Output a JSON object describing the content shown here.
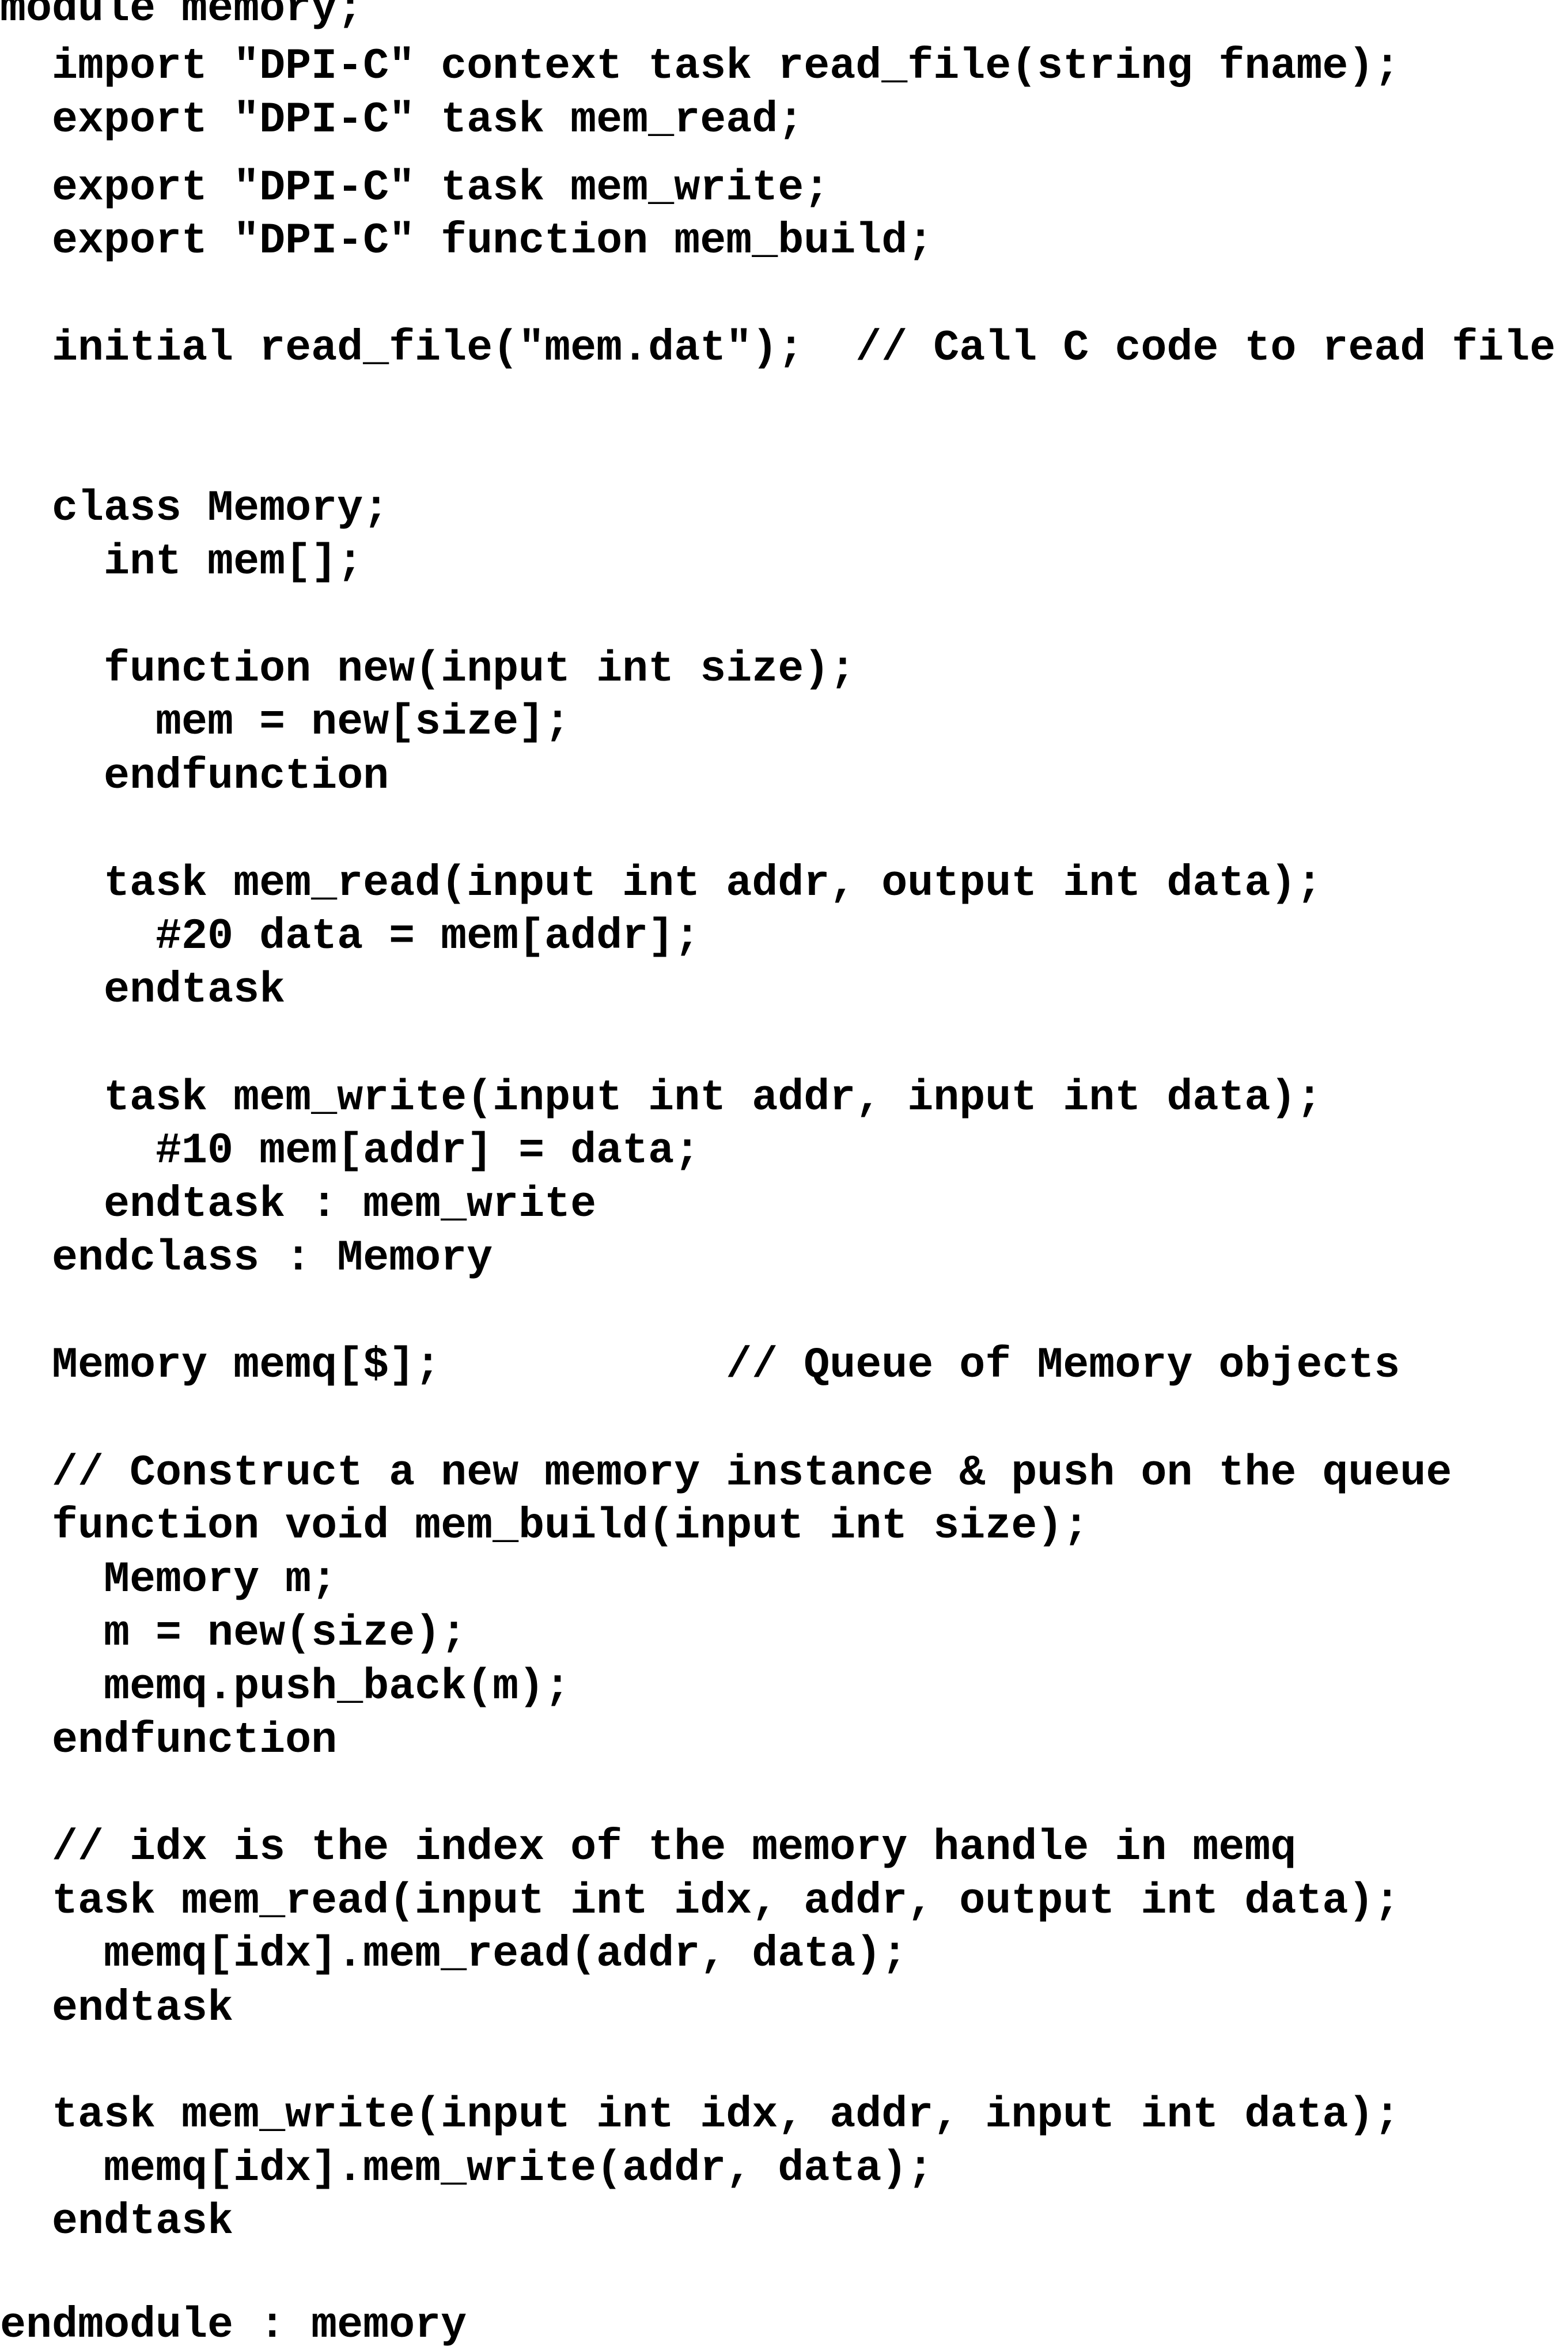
{
  "code_lines": [
    "module memory;",
    "  import \"DPI-C\" context task read_file(string fname);",
    "  export \"DPI-C\" task mem_read;",
    "  export \"DPI-C\" task mem_write;",
    "  export \"DPI-C\" function mem_build;",
    "  initial read_file(\"mem.dat\");  // Call C code to read file",
    "  class Memory;",
    "    int mem[];",
    "    function new(input int size);",
    "      mem = new[size];",
    "    endfunction",
    "    task mem_read(input int addr, output int data);",
    "      #20 data = mem[addr];",
    "    endtask",
    "    task mem_write(input int addr, input int data);",
    "      #10 mem[addr] = data;",
    "    endtask : mem_write",
    "  endclass : Memory",
    "  Memory memq[$];           // Queue of Memory objects",
    "  // Construct a new memory instance & push on the queue",
    "  function void mem_build(input int size);",
    "    Memory m;",
    "    m = new(size);",
    "    memq.push_back(m);",
    "  endfunction",
    "  // idx is the index of the memory handle in memq",
    "  task mem_read(input int idx, addr, output int data);",
    "    memq[idx].mem_read(addr, data);",
    "  endtask",
    "  task mem_write(input int idx, addr, input int data);",
    "    memq[idx].mem_write(addr, data);",
    "  endtask",
    "endmodule : memory"
  ]
}
